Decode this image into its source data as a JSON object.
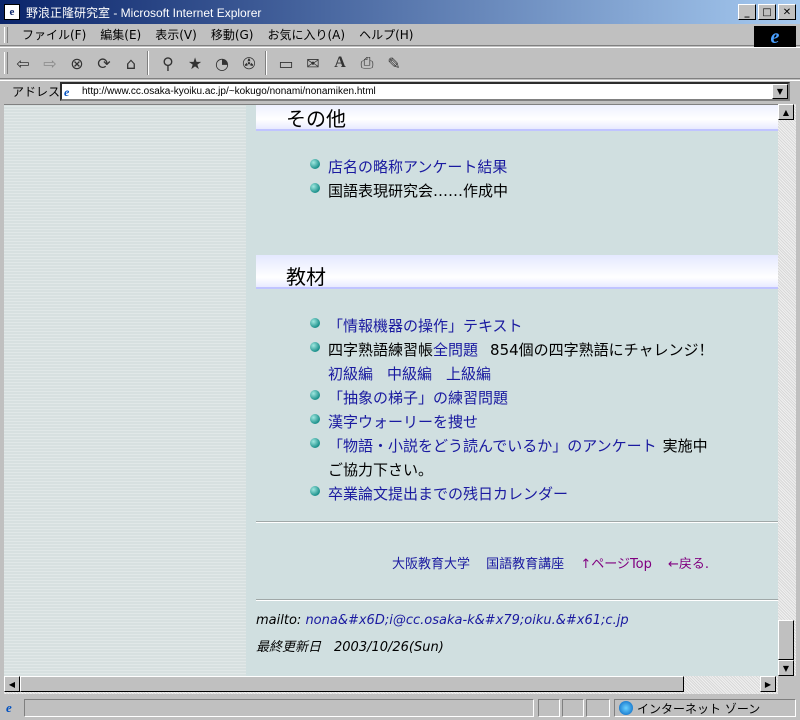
{
  "window": {
    "title": "野浪正隆研究室 - Microsoft Internet Explorer",
    "app_icon": "e"
  },
  "menu": [
    "ファイル(F)",
    "編集(E)",
    "表示(V)",
    "移動(G)",
    "お気に入り(A)",
    "ヘルプ(H)"
  ],
  "address": {
    "label": "アドレス",
    "url": "http://www.cc.osaka-kyoiku.ac.jp/~kokugo/nonami/nonamiken.html"
  },
  "toolbar_icons": [
    "back-icon",
    "forward-icon",
    "stop-icon",
    "refresh-icon",
    "home-icon",
    "search-icon",
    "favorites-icon",
    "history-icon",
    "channels-icon",
    "fullscreen-icon",
    "mail-icon",
    "font-icon",
    "print-icon",
    "edit-icon"
  ],
  "section_other": {
    "title": "その他",
    "items": [
      {
        "text": "店名の略称アンケート結果"
      },
      {
        "text": "国語表現研究会……作成中"
      }
    ]
  },
  "section_material": {
    "title": "教材",
    "item1": "「情報機器の操作」テキスト",
    "item2_prefix": "四字熟語練習帳",
    "item2_link": "全問題",
    "item2_suffix": "854個の四字熟語にチャレンジ！",
    "item2_sub": [
      "初級編",
      "中級編",
      "上級編"
    ],
    "item3": "「抽象の梯子」の練習問題",
    "item4": "漢字ウォーリーを捜せ",
    "item5_link": "「物語・小説をどう読んでいるか」のアンケート",
    "item5_suffix": "実施中",
    "item5_line2": "ご協力下さい。",
    "item6": "卒業論文提出までの残日カレンダー"
  },
  "footer": {
    "links": [
      "大阪教育大学",
      "国語教育講座"
    ],
    "page_top": "↑ページTop",
    "back": "←戻る."
  },
  "mailto_label": "mailto:",
  "mailto_address": "nona&#x6D;i@cc.osaka-k&#x79;oiku.&#x61;c.jp",
  "updated": "最終更新日　2003/10/26(Sun)",
  "status": {
    "zone": "インターネット ゾーン"
  }
}
